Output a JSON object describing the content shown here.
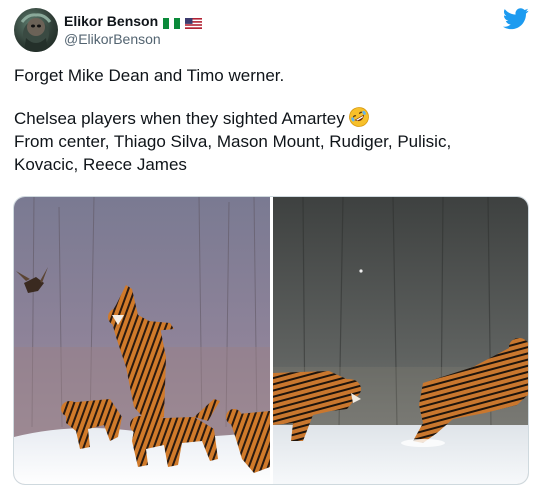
{
  "author": {
    "display_name": "Elikor Benson",
    "handle": "@ElikorBenson",
    "flags": [
      "nigeria-flag-icon",
      "us-flag-icon"
    ]
  },
  "tweet": {
    "line1": "Forget Mike Dean and Timo werner.",
    "line2": "Chelsea players when they sighted Amartey",
    "line2_emoji": "rolling-on-floor-laughing-emoji",
    "line3": "From center, Thiago Silva, Mason Mount, Rudiger, Pulisic,",
    "line4": "Kovacic, Reece James"
  },
  "media": {
    "photos": [
      "tigers-leaping-at-bird-photo",
      "tigers-leaping-in-snow-photo"
    ]
  },
  "colors": {
    "twitter_blue": "#1d9bf0",
    "handle_gray": "#536471",
    "text": "#0f1419",
    "border": "#cfd9de"
  }
}
